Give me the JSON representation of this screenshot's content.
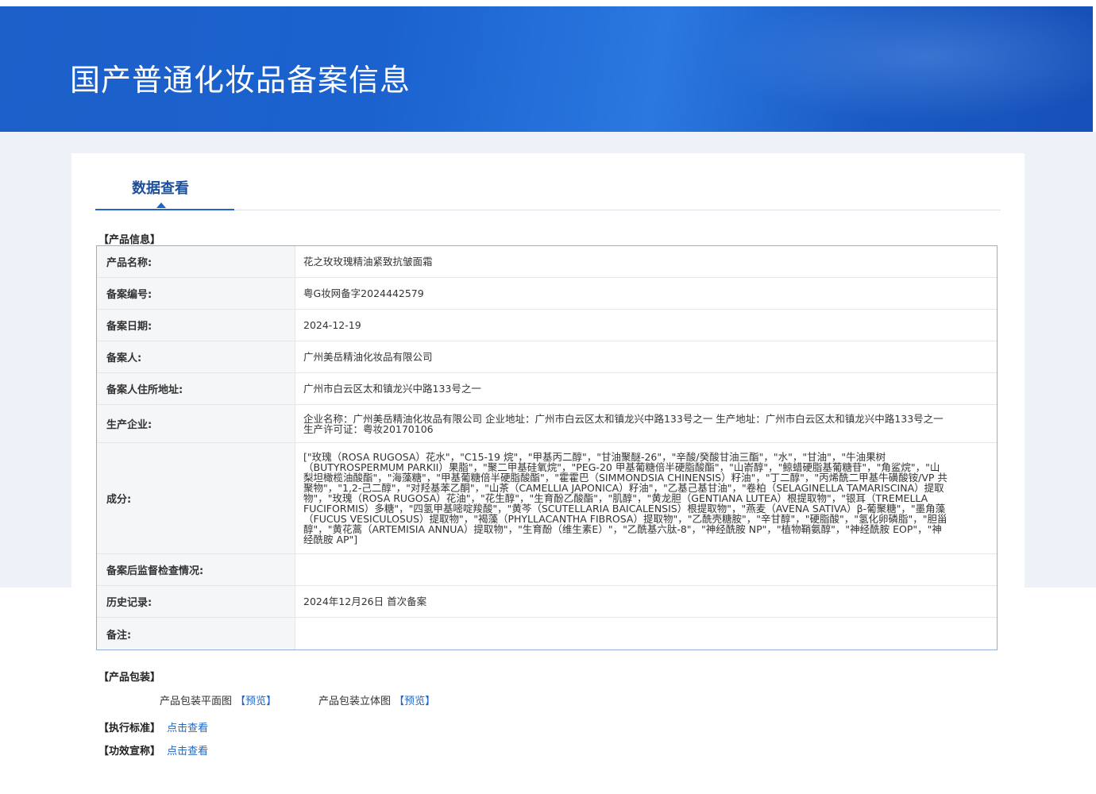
{
  "header": {
    "title": "国产普通化妆品备案信息"
  },
  "tabs": {
    "active_label": "数据查看"
  },
  "product_info": {
    "heading": "【产品信息】",
    "rows": [
      {
        "label": "产品名称:",
        "value": "花之玫玫瑰精油紧致抗皱面霜"
      },
      {
        "label": "备案编号:",
        "value": "粤G妆网备字2024442579"
      },
      {
        "label": "备案日期:",
        "value": "2024-12-19"
      },
      {
        "label": "备案人:",
        "value": "广州美岳精油化妆品有限公司"
      },
      {
        "label": "备案人住所地址:",
        "value": "广州市白云区太和镇龙兴中路133号之一"
      },
      {
        "label": "生产企业:",
        "value": "企业名称：广州美岳精油化妆品有限公司 企业地址：广州市白云区太和镇龙兴中路133号之一 生产地址：广州市白云区太和镇龙兴中路133号之一 生产许可证：粤妆20170106"
      },
      {
        "label": "成分:",
        "value": "[\"玫瑰（ROSA RUGOSA）花水\"，\"C15-19 烷\"，\"甲基丙二醇\"，\"甘油聚醚-26\"，\"辛酸/癸酸甘油三酯\"，\"水\"，\"甘油\"，\"牛油果树（BUTYROSPERMUM PARKII）果脂\"，\"聚二甲基硅氧烷\"，\"PEG-20 甲基葡糖倍半硬脂酸酯\"，\"山嵛醇\"，\"鲸蜡硬脂基葡糖苷\"，\"角鲨烷\"，\"山梨坦橄榄油酸酯\"，\"海藻糖\"，\"甲基葡糖倍半硬脂酸酯\"，\"霍霍巴（SIMMONDSIA CHINENSIS）籽油\"，\"丁二醇\"，\"丙烯酰二甲基牛磺酸铵/VP 共聚物\"，\"1,2-己二醇\"，\"对羟基苯乙酮\"，\"山茶（CAMELLIA JAPONICA）籽油\"，\"乙基己基甘油\"，\"卷柏（SELAGINELLA TAMARISCINA）提取物\"，\"玫瑰（ROSA RUGOSA）花油\"，\"花生醇\"，\"生育酚乙酸酯\"，\"肌醇\"，\"黄龙胆（GENTIANA LUTEA）根提取物\"，\"银耳（TREMELLA FUCIFORMIS）多糖\"，\"四氢甲基嘧啶羧酸\"，\"黄芩（SCUTELLARIA BAICALENSIS）根提取物\"，\"燕麦（AVENA SATIVA）β-葡聚糖\"，\"墨角藻（FUCUS VESICULOSUS）提取物\"，\"褐藻（PHYLLACANTHA FIBROSA）提取物\"，\"乙酰壳糖胺\"，\"辛甘醇\"，\"硬脂酸\"，\"氢化卵磷脂\"，\"胆甾醇\"，\"黄花蒿（ARTEMISIA ANNUA）提取物\"，\"生育酚（维生素E）\"，\"乙酰基六肽-8\"，\"神经酰胺 NP\"，\"植物鞘氨醇\"，\"神经酰胺 EOP\"，\"神经酰胺 AP\"]"
      },
      {
        "label": "备案后监督检查情况:",
        "value": ""
      },
      {
        "label": "历史记录:",
        "value": "2024年12月26日 首次备案"
      },
      {
        "label": "备注:",
        "value": ""
      }
    ]
  },
  "packaging": {
    "heading": "【产品包装】",
    "flat_label": "产品包装平面图",
    "flat_link": "【预览】",
    "solid_label": "产品包装立体图",
    "solid_link": "【预览】"
  },
  "standard": {
    "heading": "【执行标准】",
    "link": "点击查看"
  },
  "efficacy": {
    "heading": "【功效宣称】",
    "link": "点击查看"
  },
  "colors": {
    "header_blue": "#1c5fc9",
    "link_blue": "#1e67c9",
    "table_border": "#8fb0dd"
  }
}
